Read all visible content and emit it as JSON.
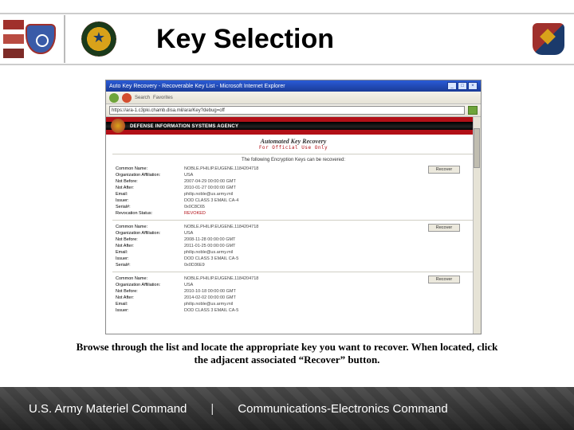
{
  "slide": {
    "title": "Key Selection",
    "caption": "Browse through the list and locate the appropriate key you want to recover.  When located, click the adjacent associated “Recover” button."
  },
  "footer": {
    "left": "U.S. Army Materiel Command",
    "sep": "|",
    "right": "Communications-Electronics Command"
  },
  "browser": {
    "window_title": "Auto Key Recovery - Recoverable Key List - Microsoft Internet Explorer",
    "toolbar_favorites": "Favorites",
    "toolbar_search": "Search",
    "address": "https://ara-1.c3pki.chamb.disa.mil/ara/Key?debug=off",
    "disa_text": "DEFENSE INFORMATION SYSTEMS AGENCY",
    "akr_title": "Automated Key Recovery",
    "akr_fouo": "For Official Use Only",
    "recoverable_note": "The following Encryption Keys can be recovered:",
    "recover_label": "Recover",
    "labels": {
      "common_name": "Common Name:",
      "org_affil": "Organization Affiliation:",
      "not_before": "Not Before:",
      "not_after": "Not After:",
      "email": "Email:",
      "issuer": "Issuer:",
      "serial": "Serial#:",
      "revocation": "Revocation Status:"
    },
    "keys": [
      {
        "common_name": "NOBLE.PHILIP.EUGENE.1184204718",
        "org_affil": "USA",
        "not_before": "2007-04-29 00:00:00 GMT",
        "not_after": "2010-01-27 00:00:00 GMT",
        "email": "philip.noble@us.army.mil",
        "issuer": "DOD CLASS 3 EMAIL CA-4",
        "serial": "0x0C8C65",
        "revocation": "REVOKED"
      },
      {
        "common_name": "NOBLE.PHILIP.EUGENE.1184204718",
        "org_affil": "USA",
        "not_before": "2008-11-28 00:00:00 GMT",
        "not_after": "2011-01-25 00:00:00 GMT",
        "email": "philip.noble@us.army.mil",
        "issuer": "DOD CLASS 3 EMAIL CA-5",
        "serial": "0x0D36E9",
        "revocation": ""
      },
      {
        "common_name": "NOBLE.PHILIP.EUGENE.1184204718",
        "org_affil": "USA",
        "not_before": "2010-10-18 00:00:00 GMT",
        "not_after": "2014-02-02 00:00:00 GMT",
        "email": "philip.noble@us.army.mil",
        "issuer": "DOD CLASS 3 EMAIL CA-5",
        "serial": "",
        "revocation": ""
      }
    ]
  }
}
